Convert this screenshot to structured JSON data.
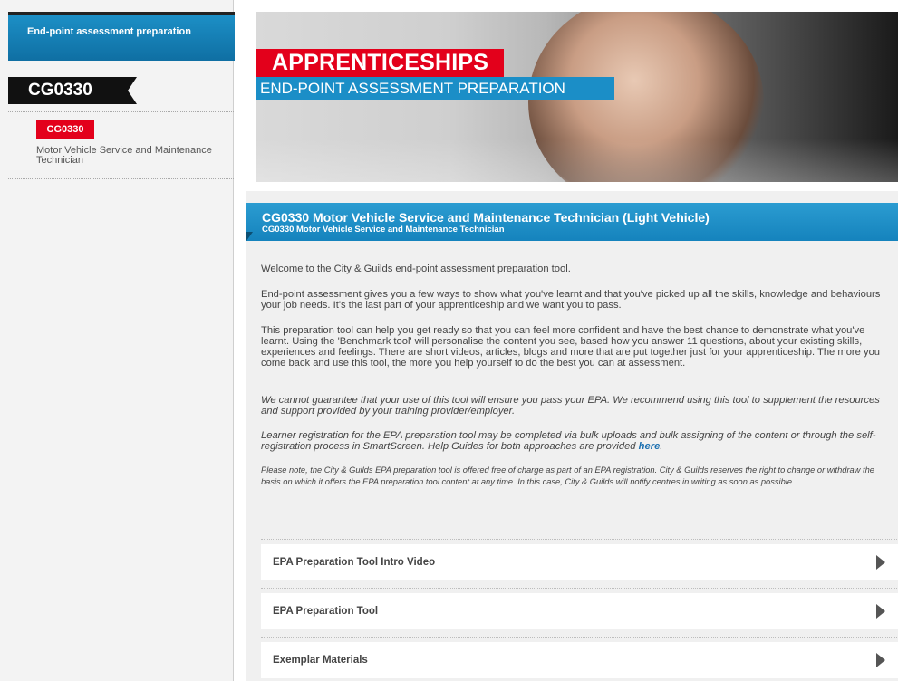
{
  "sidebar": {
    "header": "End-point assessment preparation",
    "code": "CG0330",
    "badge": "CG0330",
    "description": "Motor Vehicle Service and Maintenance Technician"
  },
  "banner": {
    "title": "APPRENTICESHIPS",
    "subtitle": "END-POINT ASSESSMENT PREPARATION"
  },
  "panel": {
    "title": "CG0330 Motor Vehicle Service and Maintenance Technician (Light Vehicle)",
    "subtitle": "CG0330 Motor Vehicle Service and Maintenance Technician",
    "paragraphs": [
      "Welcome to the City & Guilds end-point assessment preparation tool.",
      "End-point assessment gives you a few ways to show what you've learnt and that you've picked up all the skills, knowledge and behaviours your job needs. It's the last part of your apprenticeship and we want you to pass.",
      "This preparation tool can help you get ready so that you can feel more confident and have the best chance to demonstrate what you've learnt. Using the 'Benchmark tool' will personalise the content you see, based how you answer 11 questions, about your existing skills, experiences and feelings. There are short videos, articles, blogs and more that are put together just for your apprenticeship. The more you come back and use this tool, the more you help yourself to do the best you can at assessment.",
      "We cannot guarantee that your use of this tool will ensure you pass your EPA. We recommend using this tool to supplement the resources and support provided by your training provider/employer.",
      "Please note, the City & Guilds EPA preparation tool is offered free of charge as part of an EPA registration. City & Guilds reserves the right to change or withdraw the basis on which it offers the EPA preparation tool content at any time. In this case, City & Guilds will notify centres in writing as soon as possible."
    ],
    "registration_text": "Learner registration for the EPA preparation tool may be completed via bulk uploads and bulk assigning of the content or through the self-registration process in SmartScreen. Help Guides for both approaches are provided ",
    "registration_link": "here",
    "registration_end": "."
  },
  "accordion": [
    {
      "label": "EPA Preparation Tool Intro Video"
    },
    {
      "label": "EPA Preparation Tool"
    },
    {
      "label": "Exemplar Materials"
    }
  ],
  "colors": {
    "brand_red": "#e3001b",
    "brand_blue": "#1b8ec7"
  },
  "icons": {
    "accordion": "triangle-right-icon"
  }
}
